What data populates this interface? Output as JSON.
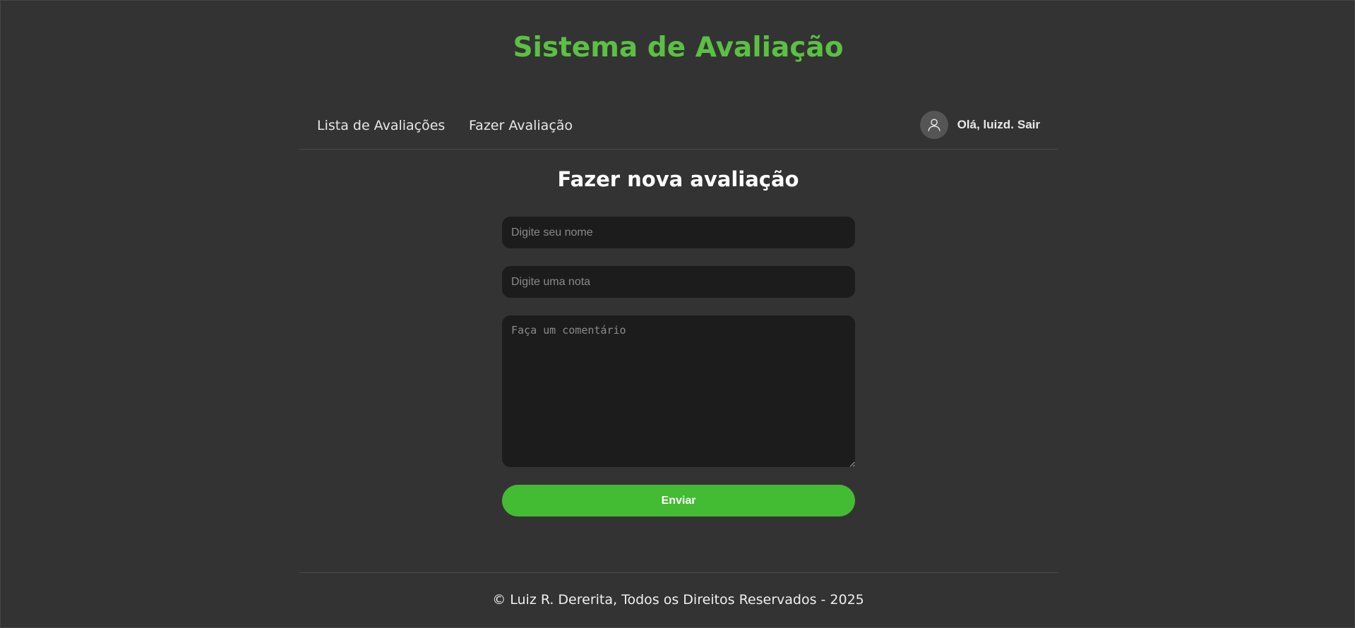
{
  "header": {
    "title": "Sistema de Avaliação"
  },
  "nav": {
    "links": [
      {
        "label": "Lista de Avaliações"
      },
      {
        "label": "Fazer Avaliação"
      }
    ],
    "user": {
      "greeting": "Olá, luizd.",
      "logout_label": "Sair",
      "avatar_icon": "user-icon"
    }
  },
  "form": {
    "title": "Fazer nova avaliação",
    "name_placeholder": "Digite seu nome",
    "grade_placeholder": "Digite uma nota",
    "comment_placeholder": "Faça um comentário",
    "submit_label": "Enviar"
  },
  "footer": {
    "text": "© Luiz R. Dererita, Todos os Direitos Reservados - 2025"
  },
  "colors": {
    "background": "#333333",
    "title_green": "#5bc043",
    "button_green": "#43bb33",
    "input_bg": "#1c1c1c"
  }
}
